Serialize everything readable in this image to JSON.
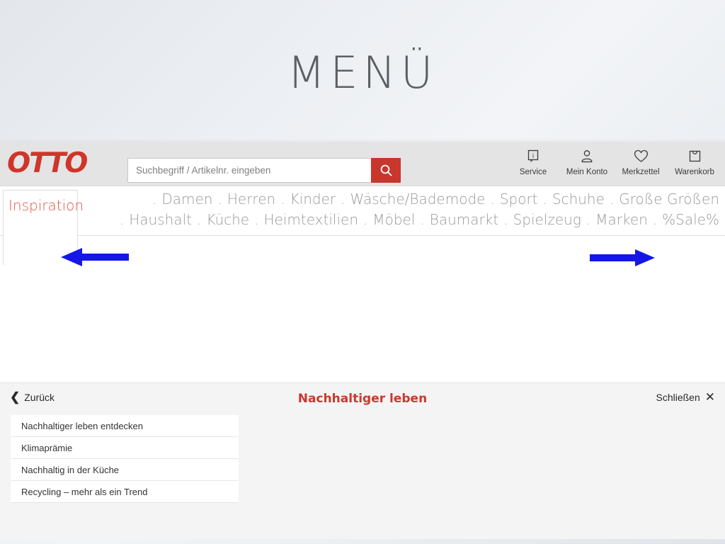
{
  "page": {
    "heading": "MENÜ"
  },
  "header": {
    "logo": "OTTO",
    "search": {
      "placeholder": "Suchbegriff / Artikelnr. eingeben",
      "value": "",
      "button_icon": "search-icon",
      "button_color": "#c8372c"
    },
    "icons": [
      {
        "label": "Service",
        "icon": "info-speech-bubble-icon"
      },
      {
        "label": "Mein Konto",
        "icon": "user-account-icon"
      },
      {
        "label": "Merkzettel",
        "icon": "heart-icon"
      },
      {
        "label": "Warenkorb",
        "icon": "shopping-bag-icon"
      }
    ]
  },
  "nav": {
    "active_tab": "Inspiration",
    "row1": [
      "Damen",
      "Herren",
      "Kinder",
      "Wäsche/Bademode",
      "Sport",
      "Schuhe",
      "Große Größen"
    ],
    "row2": [
      "Haushalt",
      "Küche",
      "Heimtextilien",
      "Möbel",
      "Baumarkt",
      "Spielzeug",
      "Marken",
      "%Sale%"
    ],
    "separator": "."
  },
  "flyout": {
    "back_label": "Zurück",
    "back_icon": "chevron-left-icon",
    "title": "Nachhaltiger leben",
    "title_color": "#cc382f",
    "close_label": "Schließen",
    "close_icon": "close-x-icon",
    "items": [
      "Nachhaltiger leben entdecken",
      "Klimaprämie",
      "Nachhaltig in der Küche",
      "Recycling – mehr als ein Trend"
    ]
  },
  "annotations": {
    "arrow_color": "#1417e8",
    "left_arrow_target": "Zurück",
    "right_arrow_target": "Schließen"
  }
}
